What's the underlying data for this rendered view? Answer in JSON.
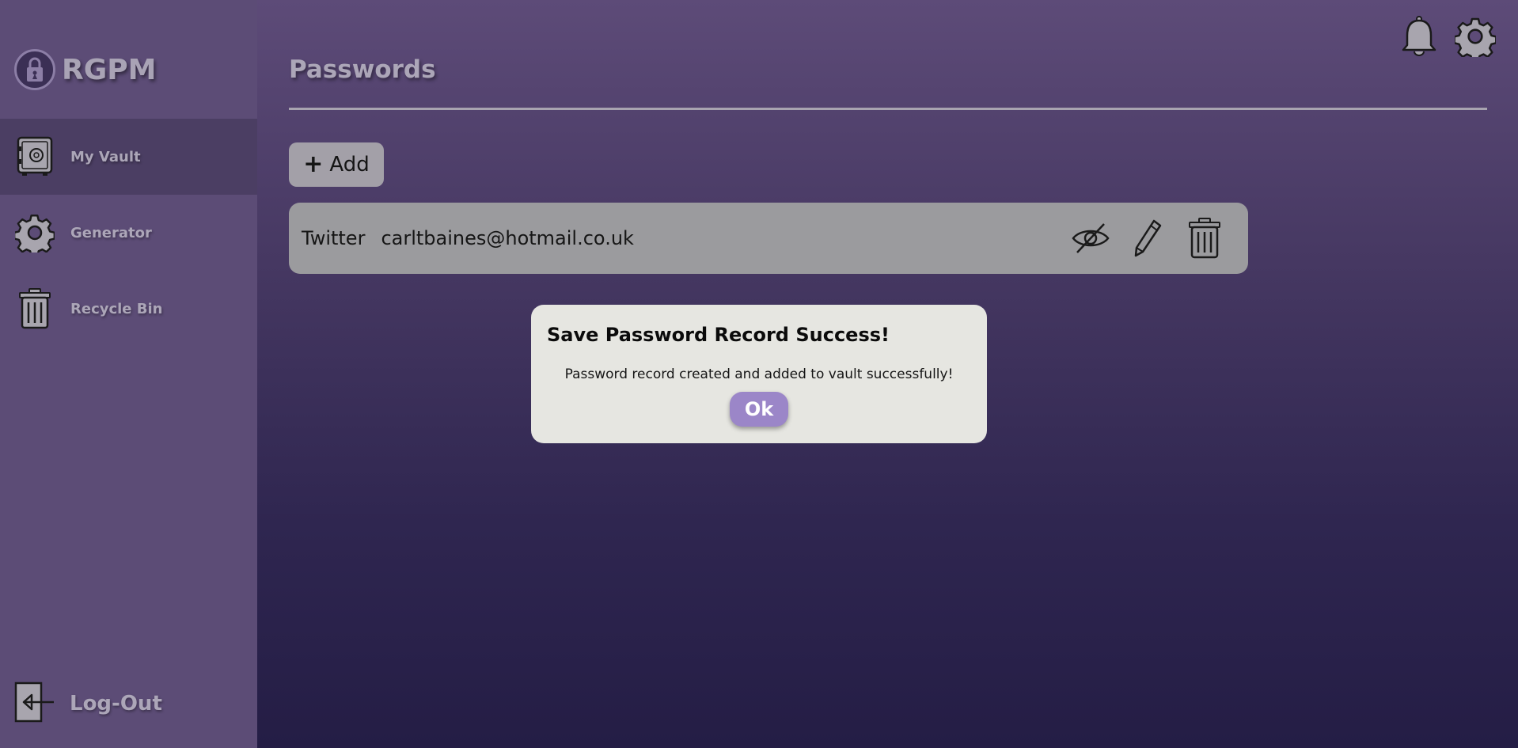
{
  "brand": {
    "name": "RGPM",
    "logo_icon": "padlock-icon"
  },
  "sidebar": {
    "items": [
      {
        "label": "My Vault",
        "icon": "safe-icon",
        "active": true
      },
      {
        "label": "Generator",
        "icon": "gear-icon",
        "active": false
      },
      {
        "label": "Recycle Bin",
        "icon": "trash-icon",
        "active": false
      }
    ],
    "logout_label": "Log-Out"
  },
  "header": {
    "title": "Passwords",
    "notification_icon": "bell-icon",
    "settings_icon": "gear-icon"
  },
  "main": {
    "add_label": "Add",
    "records": [
      {
        "site": "Twitter",
        "username": "carltbaines@hotmail.co.uk"
      }
    ]
  },
  "modal": {
    "title": "Save Password Record Success!",
    "message": "Password record created and added to vault successfully!",
    "ok_label": "Ok"
  },
  "colors": {
    "sidebar": "#5c4c76",
    "sidebar_active": "#4b3e63",
    "accent_button": "#9b86c8",
    "row_bg": "#9b9b9e",
    "modal_bg": "#e6e6e1"
  }
}
